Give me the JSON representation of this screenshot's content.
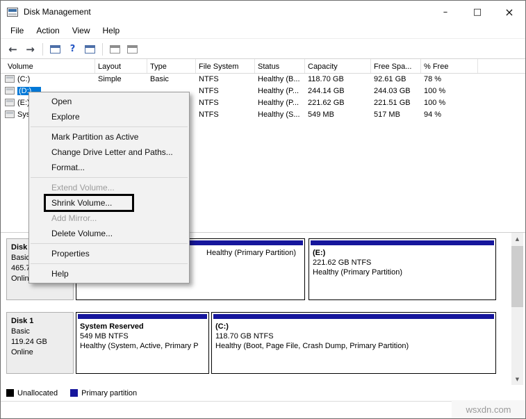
{
  "window": {
    "title": "Disk Management",
    "minimize_glyph": "–",
    "maximize_glyph": "□",
    "close_glyph": "×"
  },
  "menubar": {
    "items": [
      "File",
      "Action",
      "View",
      "Help"
    ]
  },
  "toolbar": {
    "back_glyph": "←",
    "forward_glyph": "→",
    "help_glyph": "?"
  },
  "volume_list": {
    "columns": [
      "Volume",
      "Layout",
      "Type",
      "File System",
      "Status",
      "Capacity",
      "Free Spa...",
      "% Free"
    ],
    "rows": [
      {
        "volume": "(C:)",
        "layout": "Simple",
        "type": "Basic",
        "fs": "NTFS",
        "status": "Healthy (B...",
        "capacity": "118.70 GB",
        "free_space": "92.61 GB",
        "pct_free": "78 %"
      },
      {
        "volume": "(D:)",
        "layout": "",
        "type": "",
        "fs": "NTFS",
        "status": "Healthy (P...",
        "capacity": "244.14 GB",
        "free_space": "244.03 GB",
        "pct_free": "100 %"
      },
      {
        "volume": "(E:)",
        "layout": "",
        "type": "",
        "fs": "NTFS",
        "status": "Healthy (P...",
        "capacity": "221.62 GB",
        "free_space": "221.51 GB",
        "pct_free": "100 %"
      },
      {
        "volume": "System Reserved",
        "layout": "",
        "type": "",
        "fs": "NTFS",
        "status": "Healthy (S...",
        "capacity": "549 MB",
        "free_space": "517 MB",
        "pct_free": "94 %"
      }
    ]
  },
  "context_menu": {
    "items": [
      {
        "label": "Open"
      },
      {
        "label": "Explore"
      },
      {
        "type": "separator"
      },
      {
        "label": "Mark Partition as Active"
      },
      {
        "label": "Change Drive Letter and Paths..."
      },
      {
        "label": "Format..."
      },
      {
        "type": "separator"
      },
      {
        "label": "Extend Volume...",
        "disabled": true
      },
      {
        "label": "Shrink Volume...",
        "highlighted": true
      },
      {
        "label": "Add Mirror...",
        "disabled": true
      },
      {
        "label": "Delete Volume..."
      },
      {
        "type": "separator"
      },
      {
        "label": "Properties"
      },
      {
        "type": "separator"
      },
      {
        "label": "Help"
      }
    ]
  },
  "graphical_view": {
    "disks": [
      {
        "header": {
          "name": "Disk 0",
          "type": "Basic",
          "size": "465.76 GB",
          "status": "Online"
        },
        "partitions": [
          {
            "name": "",
            "size_fs": "",
            "status": "Healthy (Primary Partition)"
          },
          {
            "name": "(E:)",
            "size_fs": "221.62 GB NTFS",
            "status": "Healthy (Primary Partition)"
          }
        ]
      },
      {
        "header": {
          "name": "Disk 1",
          "type": "Basic",
          "size": "119.24 GB",
          "status": "Online"
        },
        "partitions": [
          {
            "name": "System Reserved",
            "size_fs": "549 MB NTFS",
            "status": "Healthy (System, Active, Primary P"
          },
          {
            "name": "(C:)",
            "size_fs": "118.70 GB NTFS",
            "status": "Healthy (Boot, Page File, Crash Dump, Primary Partition)"
          }
        ]
      }
    ]
  },
  "legend": {
    "items": [
      {
        "label": "Unallocated",
        "color": "#000000"
      },
      {
        "label": "Primary partition",
        "color": "#16169c"
      }
    ]
  },
  "watermark": "wsxdn.com",
  "colors": {
    "primary_partition": "#16169c",
    "unallocated": "#000000",
    "selection": "#0078d7"
  }
}
